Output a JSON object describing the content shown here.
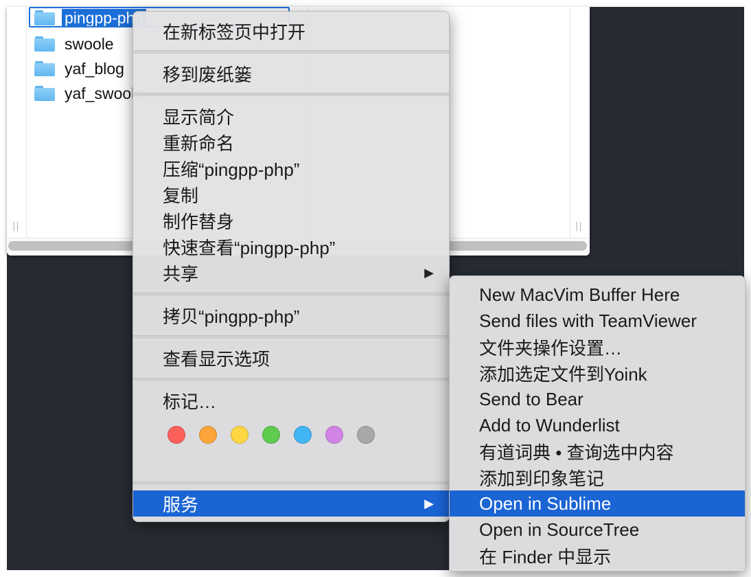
{
  "finder": {
    "files": [
      {
        "name": "pingpp-php",
        "selected": true
      },
      {
        "name": "swoole",
        "selected": false
      },
      {
        "name": "yaf_blog",
        "selected": false
      },
      {
        "name": "yaf_swoole",
        "selected": false
      }
    ],
    "resize_handle": "||"
  },
  "context_menu": {
    "open_in_new_tab": "在新标签页中打开",
    "move_to_trash": "移到废纸篓",
    "get_info": "显示简介",
    "rename": "重新命名",
    "compress": "压缩“pingpp-php”",
    "duplicate": "复制",
    "make_alias": "制作替身",
    "quick_look": "快速查看“pingpp-php”",
    "share": "共享",
    "copy": "拷贝“pingpp-php”",
    "show_view_options": "查看显示选项",
    "tags": "标记…",
    "tag_colors": [
      "#fc605b",
      "#fda43a",
      "#fdd644",
      "#5fcb4f",
      "#42b5f5",
      "#d184e6",
      "#a8a8a8"
    ],
    "services": "服务",
    "submenu_arrow": "▶"
  },
  "services_submenu": {
    "items": [
      "New MacVim Buffer Here",
      "Send files with TeamViewer",
      "文件夹操作设置…",
      "添加选定文件到Yoink",
      "Send to Bear",
      "Add to Wunderlist",
      "有道词典 • 查询选中内容",
      "添加到印象笔记",
      "Open in Sublime",
      "Open in SourceTree",
      "在 Finder 中显示"
    ],
    "highlighted_index": 8
  },
  "colors": {
    "highlight": "#1a64d4",
    "selection": "#1c6fd8",
    "desktop": "#272b33"
  }
}
